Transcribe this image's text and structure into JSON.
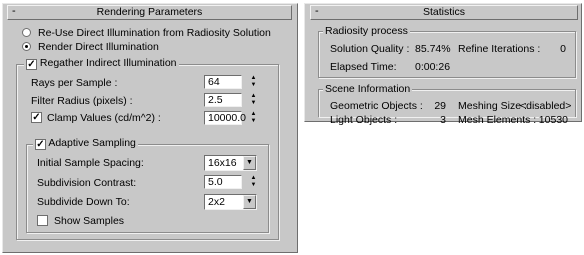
{
  "rendering": {
    "header": {
      "collapse": "-",
      "title": "Rendering Parameters"
    },
    "radio_reuse": "Re-Use Direct Illumination from Radiosity Solution",
    "radio_render": "Render Direct Illumination",
    "regather": {
      "label": "Regather Indirect Illumination",
      "checked": true
    },
    "rays_label": "Rays per Sample :",
    "rays_value": "64",
    "filter_label": "Filter Radius (pixels) :",
    "filter_value": "2.5",
    "clamp": {
      "label": "Clamp Values (cd/m^2) :",
      "checked": true
    },
    "clamp_value": "10000.0",
    "adaptive": {
      "label": "Adaptive Sampling",
      "checked": true
    },
    "initial_label": "Initial Sample Spacing:",
    "initial_value": "16x16",
    "contrast_label": "Subdivision Contrast:",
    "contrast_value": "5.0",
    "subdivide_label": "Subdivide Down To:",
    "subdivide_value": "2x2",
    "show_samples": {
      "label": "Show Samples",
      "checked": false
    }
  },
  "statistics": {
    "header": {
      "collapse": "-",
      "title": "Statistics"
    },
    "radiosity_title": "Radiosity process",
    "quality_label": "Solution Quality :",
    "quality_value": "85.74%",
    "refine_label": "Refine Iterations :",
    "refine_value": "0",
    "elapsed_label": "Elapsed Time:",
    "elapsed_value": "0:00:26",
    "scene_title": "Scene Information",
    "geom_label": "Geometric Objects :",
    "geom_value": "29",
    "meshing_label": "Meshing Size :",
    "meshing_value": "<disabled>",
    "light_label": "Light Objects :",
    "light_value": "3",
    "mesh_label": "Mesh Elements :",
    "mesh_value": "10530"
  }
}
